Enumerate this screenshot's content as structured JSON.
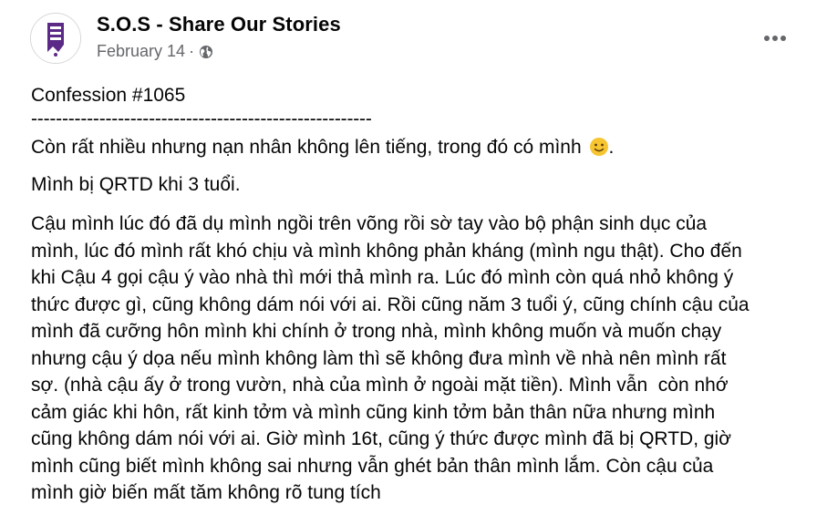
{
  "post": {
    "page_name": "S.O.S - Share Our Stories",
    "date": "February 14",
    "separator": "·",
    "privacy_icon": "globe-icon",
    "more_icon": "more-horizontal-icon",
    "avatar_icon": "page-avatar-logo",
    "title": "Confession #1065",
    "divider": "-------------------------------------------------------",
    "line1_text": "Còn rất nhiều nhưng nạn nhân không lên tiếng, trong đó có mình",
    "line1_emoji": "slightly-smiling-face-emoji",
    "line1_end": ".",
    "line2": "Mình bị QRTD khi 3 tuổi.",
    "paragraph_lines": [
      "Cậu mình lúc đó đã dụ mình ngồi trên võng rồi sờ tay vào bộ phận sinh dục của",
      "mình, lúc đó mình rất khó chịu và mình không phản kháng (mình ngu thật). Cho đến",
      "khi Cậu 4 gọi cậu ý vào nhà thì mới thả mình ra. Lúc đó mình còn quá nhỏ không ý",
      "thức được gì, cũng không dám nói với ai. Rồi cũng năm 3 tuổi ý, cũng chính cậu của",
      "mình đã cưỡng hôn mình khi chính ở trong nhà, mình không muốn và muốn chạy",
      "nhưng cậu ý dọa nếu mình không làm thì sẽ không đưa mình về nhà nên mình rất",
      "sợ. (nhà cậu ấy ở trong vườn, nhà của mình ở ngoài mặt tiền). Mình vẫn  còn nhớ",
      "cảm giác khi hôn, rất kinh tởm và mình cũng kinh tởm bản thân nữa nhưng mình",
      "cũng không dám nói với ai. Giờ mình 16t, cũng ý thức được mình đã bị QRTD, giờ",
      "mình cũng biết mình không sai nhưng vẫn ghét bản thân mình lắm. Còn cậu của",
      "mình giờ biến mất tăm không rõ tung tích"
    ],
    "trailing": "."
  },
  "colors": {
    "text": "#050505",
    "secondary_text": "#65676b",
    "avatar_purple": "#5b2a86",
    "emoji_yellow": "#f7c531"
  }
}
